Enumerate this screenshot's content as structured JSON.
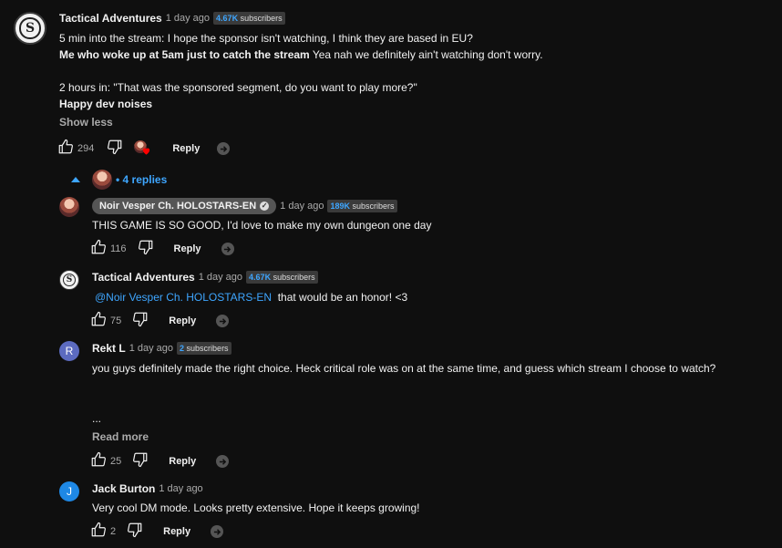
{
  "comment": {
    "author": "Tactical Adventures",
    "time": "1 day ago",
    "subs_count": "4.67K",
    "subs_label": "subscribers",
    "line1": "5 min into the stream: I hope the sponsor isn't watching, I think they are based in EU?",
    "line2_bold": "Me who woke up at 5am just to catch the stream",
    "line2_rest": " Yea nah we definitely ain't watching don't worry.",
    "line3": "2 hours in: \"That was the sponsored segment, do you want to play more?\"",
    "line4": "Happy dev noises",
    "show_less": "Show less",
    "likes": "294",
    "reply_label": "Reply"
  },
  "replies_toggle": {
    "dot": "•",
    "label": "4 replies"
  },
  "replies": [
    {
      "author": "Noir Vesper Ch. HOLOSTARS-EN",
      "verified_icon": "check-icon",
      "time": "1 day ago",
      "subs_count": "189K",
      "subs_label": "subscribers",
      "text": "THIS GAME IS SO GOOD, I'd love to make my own dungeon one day",
      "likes": "116",
      "reply_label": "Reply"
    },
    {
      "author": "Tactical Adventures",
      "time": "1 day ago",
      "subs_count": "4.67K",
      "subs_label": "subscribers",
      "mention": "@Noir Vesper Ch. HOLOSTARS-EN",
      "text": "that would be an honor! <3",
      "likes": "75",
      "reply_label": "Reply"
    },
    {
      "author": "Rekt L",
      "avatar_letter": "R",
      "avatar_color": "#5c6bc0",
      "time": "1 day ago",
      "subs_count": "2",
      "subs_label": "subscribers",
      "text": "you guys definitely made the right choice. Heck critical role was on at the same time, and guess which stream I choose to watch?",
      "ellipsis": "...",
      "read_more": "Read more",
      "likes": "25",
      "reply_label": "Reply"
    },
    {
      "author": "Jack Burton",
      "avatar_letter": "J",
      "avatar_color": "#1e88e5",
      "time": "1 day ago",
      "text": "Very cool DM mode. Looks pretty extensive. Hope it keeps growing!",
      "likes": "2",
      "reply_label": "Reply"
    }
  ],
  "colors": {
    "background": "#0f0f0f",
    "link": "#3ea6ff",
    "heart": "#ff0000"
  }
}
